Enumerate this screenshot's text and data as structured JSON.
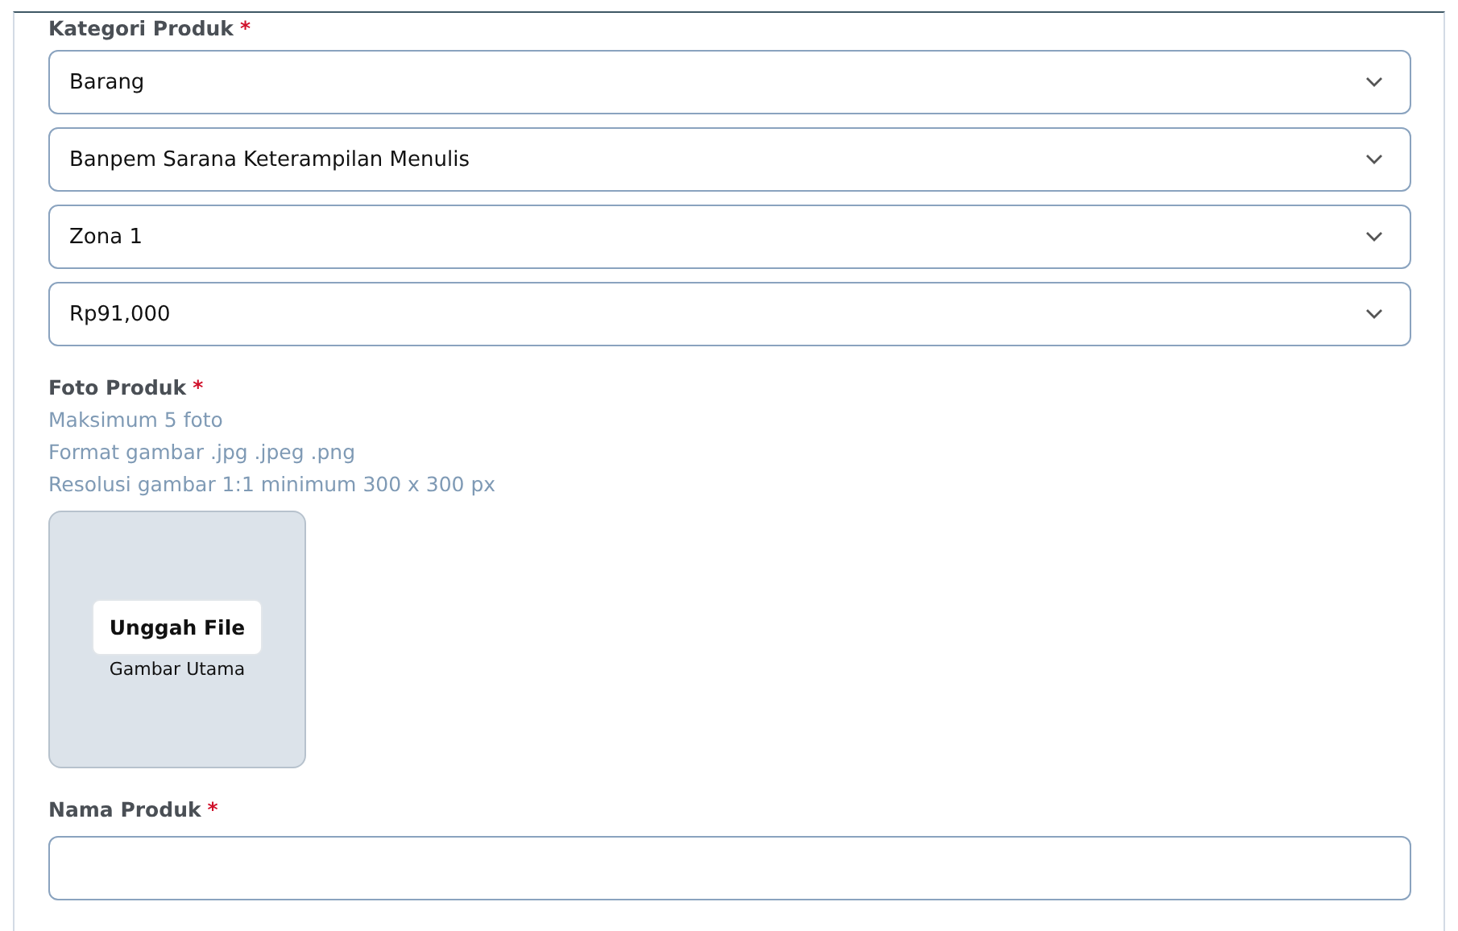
{
  "category": {
    "label": "Kategori Produk",
    "required_mark": "*",
    "selects": [
      {
        "value": "Barang"
      },
      {
        "value": "Banpem Sarana Keterampilan Menulis"
      },
      {
        "value": "Zona 1"
      },
      {
        "value": "Rp91,000"
      }
    ]
  },
  "photo": {
    "label": "Foto Produk",
    "required_mark": "*",
    "hints": [
      "Maksimum 5 foto",
      "Format gambar .jpg .jpeg .png",
      "Resolusi gambar 1:1 minimum 300 x 300 px"
    ],
    "upload_button": "Unggah File",
    "slot_caption": "Gambar Utama"
  },
  "name": {
    "label": "Nama Produk",
    "required_mark": "*"
  }
}
